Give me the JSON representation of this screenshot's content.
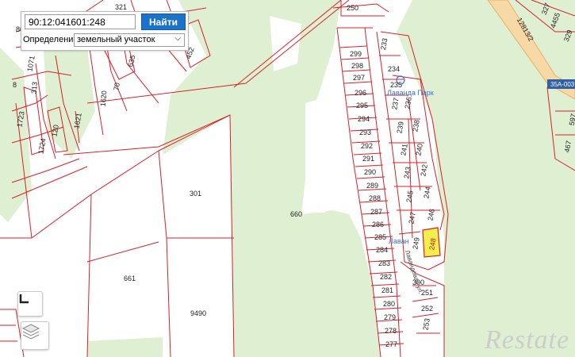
{
  "search": {
    "value": "90:12:041601:248",
    "button_label": "Найти"
  },
  "definition": {
    "label": "Определение:",
    "selected": "земельный участок"
  },
  "highlighted_parcel": "248",
  "highlight_color": "#f2ee4e",
  "boundary_color": "#d8202a",
  "forest_color": "#dff0d2",
  "places": {
    "resort": "Лаванда Парк",
    "resort_short": "Лаван",
    "street": "Лавандовая ул."
  },
  "road_label": "35А-003",
  "parcels_left": [
    "299",
    "298",
    "297",
    "296",
    "295",
    "294",
    "293",
    "292",
    "291",
    "290",
    "289",
    "288",
    "287",
    "286",
    "285",
    "284",
    "283",
    "282",
    "281",
    "280",
    "279",
    "278",
    "277"
  ],
  "parcels_right": [
    "233",
    "234",
    "235",
    "236",
    "237",
    "238",
    "239",
    "240",
    "241",
    "242",
    "243",
    "244",
    "245",
    "246",
    "247",
    "249",
    "248",
    "300",
    "251",
    "252",
    "253"
  ],
  "parcels_big": [
    "301",
    "660",
    "661",
    "9490",
    "250"
  ],
  "parcels_topleft": [
    "321",
    "336",
    "205",
    "452",
    "635",
    "70",
    "1620",
    "313",
    "1071",
    "120",
    "1621",
    "1724",
    "1723",
    "80",
    "8"
  ],
  "parcels_topright": [
    "327",
    "4455",
    "329",
    "12813/2",
    "597",
    "467"
  ],
  "watermark": "Restate",
  "controls": {
    "view_icon": "corner-frame-icon",
    "layers_icon": "layers-icon"
  }
}
